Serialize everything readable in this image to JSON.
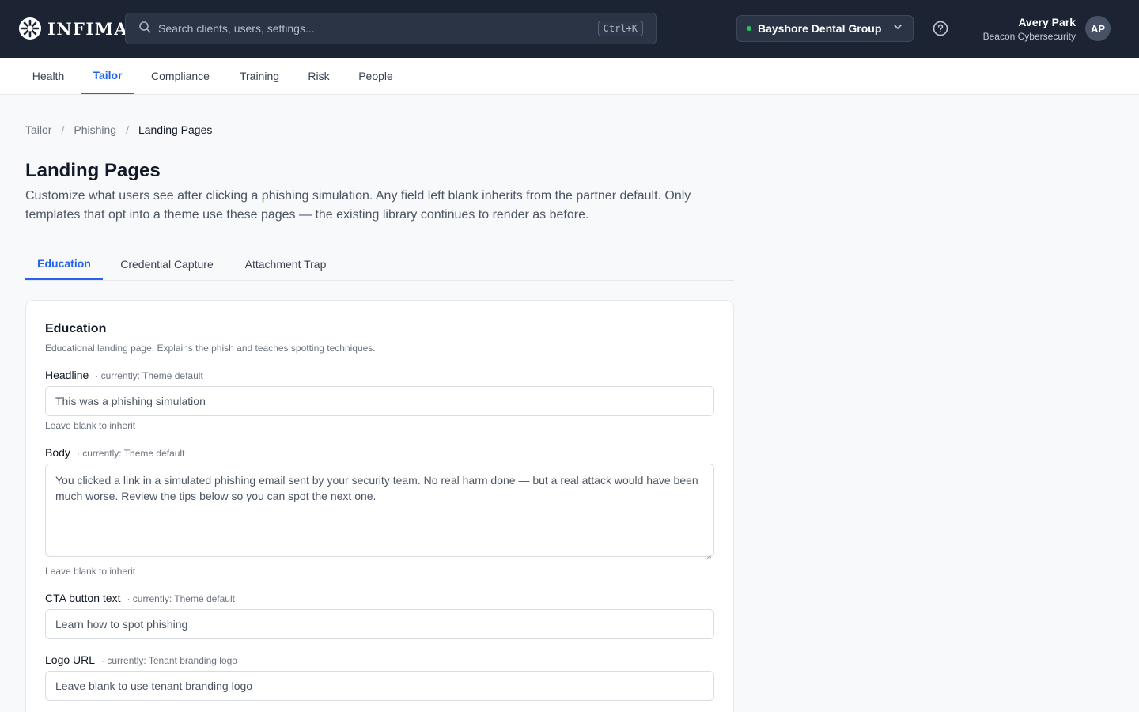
{
  "header": {
    "logo_text": "INFIMA",
    "search_placeholder": "Search clients, users, settings...",
    "search_shortcut": "Ctrl+K",
    "tenant_name": "Bayshore Dental Group",
    "tenant_status_color": "#22c55e",
    "user_name": "Avery Park",
    "user_org": "Beacon Cybersecurity",
    "avatar_initials": "AP"
  },
  "nav": {
    "items": [
      {
        "label": "Health",
        "active": false
      },
      {
        "label": "Tailor",
        "active": true
      },
      {
        "label": "Compliance",
        "active": false
      },
      {
        "label": "Training",
        "active": false
      },
      {
        "label": "Risk",
        "active": false
      },
      {
        "label": "People",
        "active": false
      }
    ]
  },
  "breadcrumb": {
    "items": [
      "Tailor",
      "Phishing",
      "Landing Pages"
    ],
    "separator": "/"
  },
  "page": {
    "title": "Landing Pages",
    "description": "Customize what users see after clicking a phishing simulation. Any field left blank inherits from the partner default. Only templates that opt into a theme use these pages — the existing library continues to render as before."
  },
  "tabs": {
    "items": [
      {
        "label": "Education",
        "active": true
      },
      {
        "label": "Credential Capture",
        "active": false
      },
      {
        "label": "Attachment Trap",
        "active": false
      }
    ]
  },
  "card": {
    "title": "Education",
    "subtitle": "Educational landing page. Explains the phish and teaches spotting techniques.",
    "fields": {
      "headline": {
        "label": "Headline",
        "current": "· currently: Theme default",
        "placeholder": "This was a phishing simulation",
        "hint": "Leave blank to inherit"
      },
      "body": {
        "label": "Body",
        "current": "· currently: Theme default",
        "placeholder": "You clicked a link in a simulated phishing email sent by your security team. No real harm done — but a real attack would have been much worse. Review the tips below so you can spot the next one.",
        "hint": "Leave blank to inherit"
      },
      "cta": {
        "label": "CTA button text",
        "current": "· currently: Theme default",
        "placeholder": "Learn how to spot phishing"
      },
      "logo_url": {
        "label": "Logo URL",
        "current": "· currently: Tenant branding logo",
        "placeholder": "Leave blank to use tenant branding logo"
      }
    }
  },
  "colors": {
    "topbar_bg": "#1c2434",
    "accent": "#2563eb"
  }
}
